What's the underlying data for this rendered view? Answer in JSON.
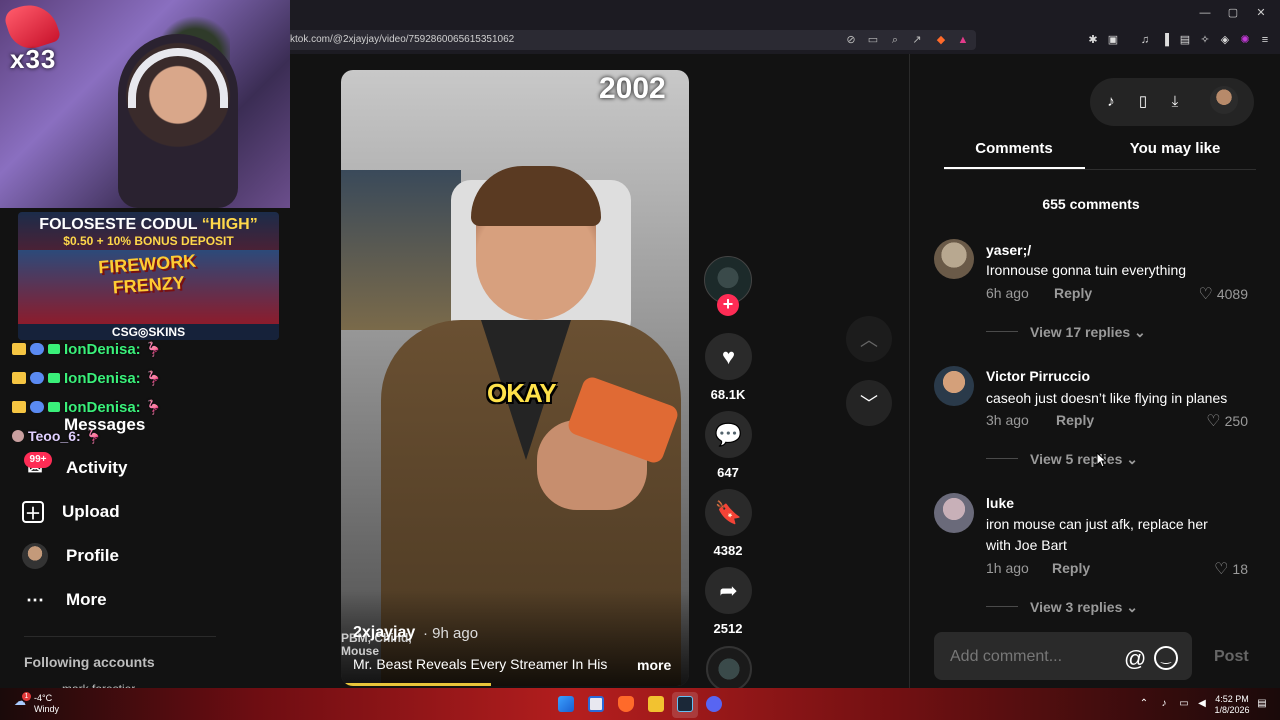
{
  "browser": {
    "url": "ktok.com/@2xjayjay/video/7592860065615351062",
    "window_controls": {
      "minimize": "—",
      "maximize": "▢",
      "close": "✕"
    }
  },
  "stream_overlay": {
    "sub_count": "x33",
    "ad": {
      "line1_prefix": "FOLOSESTE CODUL ",
      "line1_code": "“HIGH”",
      "line2": "$0.50 + 10% BONUS DEPOSIT",
      "game_title": "FIREWORK FRENZY",
      "brand": "CSG◎SKINS"
    },
    "chat": [
      {
        "user": "IonDenisa:",
        "emote": "🦩"
      },
      {
        "user": "IonDenisa:",
        "emote": "🦩"
      },
      {
        "user": "IonDenisa:",
        "emote": "🦩"
      },
      {
        "user": "Teoo_6:",
        "emote": "🦩"
      }
    ]
  },
  "sidebar": {
    "items": [
      {
        "label": "Messages",
        "icon": "✈"
      },
      {
        "label": "Activity",
        "icon": "✉",
        "badge": "99+"
      },
      {
        "label": "Upload",
        "icon": "＋"
      },
      {
        "label": "Profile",
        "icon": "avatar"
      },
      {
        "label": "More",
        "icon": "⋯"
      }
    ],
    "following_title": "Following accounts",
    "following_peek": "mark.forestier"
  },
  "video": {
    "year_overlay": "2002",
    "caption": "OKAY",
    "bg_text": "PBM, Chind, Mouse",
    "author": "2xjayjay",
    "time": "· 9h ago",
    "description": "Mr. Beast Reveals Every Streamer In His",
    "more_label": "more",
    "progress": 0.43
  },
  "actions": {
    "likes": "68.1K",
    "comments": "647",
    "bookmarks": "4382",
    "shares": "2512",
    "follow_icon": "+"
  },
  "right_panel": {
    "tabs": [
      {
        "label": "Comments",
        "active": true
      },
      {
        "label": "You may like",
        "active": false
      }
    ],
    "comment_count": "655 comments",
    "comments": [
      {
        "user": "yaser;/",
        "text": "Ironnouse gonna tuin everything",
        "time": "6h ago",
        "reply": "Reply",
        "likes": "4089",
        "view_replies": "View 17 replies"
      },
      {
        "user": "Victor Pirruccio",
        "text": "caseoh just doesn’t like flying in planes",
        "time": "3h ago",
        "reply": "Reply",
        "likes": "250",
        "view_replies": "View 5 replies"
      },
      {
        "user": "luke",
        "text": "iron mouse can just afk, replace her with Joe Bart",
        "time": "1h ago",
        "reply": "Reply",
        "likes": "18",
        "view_replies": "View 3 replies"
      }
    ],
    "input_placeholder": "Add comment...",
    "post_label": "Post"
  },
  "taskbar": {
    "weather_temp": "-4°C",
    "weather_desc": "Windy",
    "weather_badge": "1",
    "time": "4:52 PM",
    "date": "1/8/2026"
  }
}
